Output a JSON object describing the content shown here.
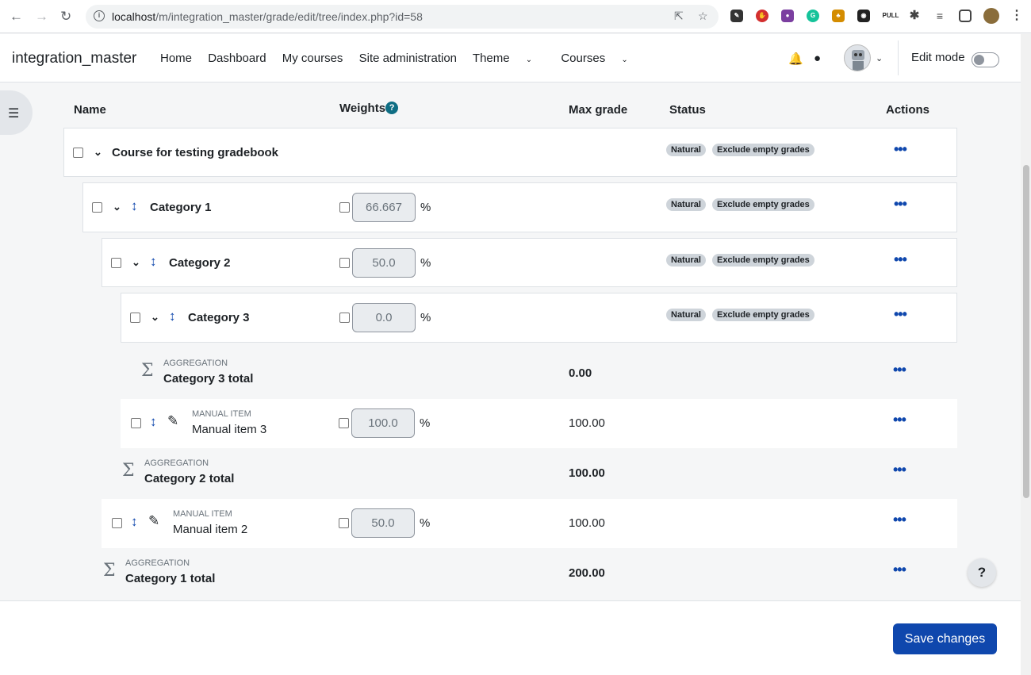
{
  "browser": {
    "url_host": "localhost",
    "url_path": "/m/integration_master/grade/edit/tree/index.php?id=58",
    "ext_label": "PULL"
  },
  "navbar": {
    "brand": "integration_master",
    "links": [
      "Home",
      "Dashboard",
      "My courses",
      "Site administration",
      "Theme",
      "Courses"
    ],
    "edit_mode_label": "Edit mode"
  },
  "table": {
    "headers": {
      "name": "Name",
      "weights": "Weights",
      "max_grade": "Max grade",
      "status": "Status",
      "actions": "Actions"
    },
    "help_glyph": "?",
    "course": {
      "name": "Course for testing gradebook",
      "badges": [
        "Natural",
        "Exclude empty grades"
      ]
    },
    "category1": {
      "name": "Category 1",
      "weight": "66.667",
      "badges": [
        "Natural",
        "Exclude empty grades"
      ]
    },
    "category2": {
      "name": "Category 2",
      "weight": "50.0",
      "badges": [
        "Natural",
        "Exclude empty grades"
      ]
    },
    "category3": {
      "name": "Category 3",
      "weight": "0.0",
      "badges": [
        "Natural",
        "Exclude empty grades"
      ]
    },
    "cat3_total": {
      "type": "AGGREGATION",
      "name": "Category 3 total",
      "max": "0.00"
    },
    "manual3": {
      "type": "MANUAL ITEM",
      "name": "Manual item 3",
      "weight": "100.0",
      "max": "100.00"
    },
    "cat2_total": {
      "type": "AGGREGATION",
      "name": "Category 2 total",
      "max": "100.00"
    },
    "manual2": {
      "type": "MANUAL ITEM",
      "name": "Manual item 2",
      "weight": "50.0",
      "max": "100.00"
    },
    "cat1_total": {
      "type": "AGGREGATION",
      "name": "Category 1 total",
      "max": "200.00"
    },
    "percent": "%"
  },
  "footer": {
    "save_label": "Save changes",
    "help_label": "?"
  },
  "colors": {
    "primary": "#0f47ad",
    "badge_bg": "#ced4da",
    "help_icon": "#0f6e84"
  }
}
